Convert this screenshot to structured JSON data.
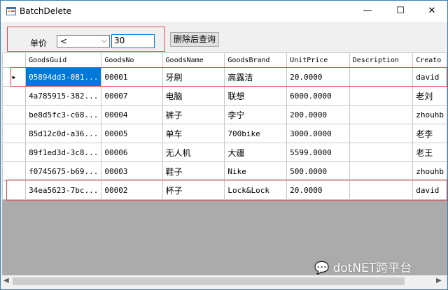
{
  "window": {
    "title": "BatchDelete",
    "minimize": "—",
    "maximize": "☐",
    "close": "✕"
  },
  "filter": {
    "label": "单价",
    "operator": "<",
    "value": "30",
    "button": "删除后查询"
  },
  "grid": {
    "columns": [
      "GoodsGuid",
      "GoodsNo",
      "GoodsName",
      "GoodsBrand",
      "UnitPrice",
      "Description",
      "Creato"
    ],
    "rows": [
      [
        "05894dd3-081...",
        "00001",
        "牙刷",
        "高露洁",
        "20.0000",
        "",
        "david"
      ],
      [
        "4a785915-382...",
        "00007",
        "电脑",
        "联想",
        "6000.0000",
        "",
        "老刘"
      ],
      [
        "be8d5fc3-c68...",
        "00004",
        "裤子",
        "李宁",
        "200.0000",
        "",
        "zhouhb"
      ],
      [
        "85d12c0d-a36...",
        "00005",
        "单车",
        "700bike",
        "3000.0000",
        "",
        "老李"
      ],
      [
        "89f1ed3d-3c8...",
        "00006",
        "无人机",
        "大疆",
        "5599.0000",
        "",
        "老王"
      ],
      [
        "f0745675-b69...",
        "00003",
        "鞋子",
        "Nike",
        "500.0000",
        "",
        "zhouhb"
      ],
      [
        "34ea5623-7bc...",
        "00002",
        "杯子",
        "Lock&Lock",
        "20.0000",
        "",
        "david"
      ]
    ],
    "current_row_marker": "▶"
  },
  "watermark": "dotNET跨平台",
  "colors": {
    "selection": "#0078d7",
    "highlight_border": "#e0454a",
    "grid_background": "#ababab"
  }
}
